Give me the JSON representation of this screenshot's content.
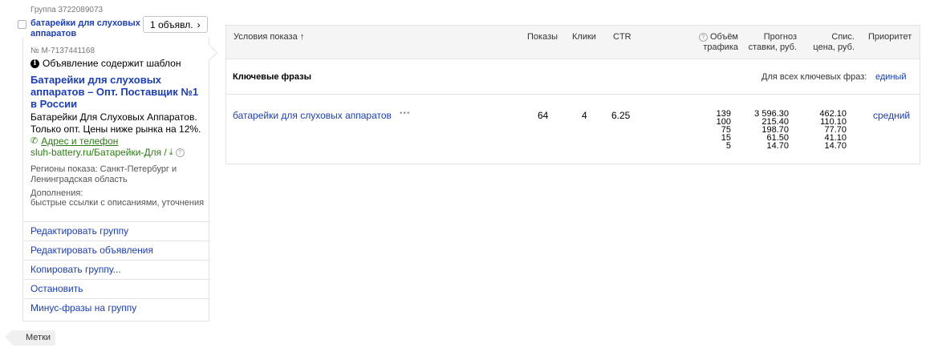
{
  "group": {
    "id_label": "Группа 3722089073",
    "name": "батарейки для слуховых аппаратов",
    "ads_count_label": "1 объявл."
  },
  "ad": {
    "number": "№ М-7137441168",
    "template_note": "Объявление содержит шаблон",
    "title": "Батарейки для слуховых аппаратов – Опт. Поставщик №1 в России",
    "text": "Батарейки Для Слуховых Аппаратов. Только опт. Цены ниже рынка на 12%.",
    "address_label": "Адрес и телефон",
    "display_url": "sluh-battery.ru/Батарейки-Для /",
    "regions": "Регионы показа: Санкт-Петербург и Ленинградская область",
    "additions_label": "Дополнения:",
    "additions_value": "быстрые ссылки с описаниями, уточнения"
  },
  "actions": [
    "Редактировать группу",
    "Редактировать объявления",
    "Копировать группу...",
    "Остановить",
    "Минус-фразы на группу"
  ],
  "tags_label": "Метки",
  "table": {
    "headers": {
      "conditions": "Условия показа ↑",
      "impressions": "Показы",
      "clicks": "Клики",
      "ctr": "CTR",
      "traffic_line1": "Объём",
      "traffic_line2": "трафика",
      "forecast_line1": "Прогноз",
      "forecast_line2": "ставки, руб.",
      "writeoff_line1": "Спис.",
      "writeoff_line2": "цена, руб.",
      "priority": "Приоритет"
    },
    "section_title": "Ключевые фразы",
    "all_phrases_label": "Для всех ключевых фраз:",
    "all_phrases_value": "единый",
    "row": {
      "phrase": "батарейки для слуховых аппаратов",
      "impressions": "64",
      "clicks": "4",
      "ctr": "6.25",
      "traffic": [
        "139",
        "100",
        "75",
        "15",
        "5"
      ],
      "forecast": [
        "3 596.30",
        "215.40",
        "198.70",
        "61.50",
        "14.70"
      ],
      "writeoff": [
        "462.10",
        "110.10",
        "77.70",
        "41.10",
        "14.70"
      ],
      "priority": "средний"
    }
  },
  "colors": {
    "link": "#1a3dc1",
    "url_green": "#2a7d12",
    "header_bg": "#f5f5f5",
    "border": "#e3e3e3"
  },
  "icons": [
    "info-icon",
    "phone-icon",
    "download-icon",
    "help-icon",
    "chevron-right-icon",
    "more-dots-icon",
    "tag-icon"
  ]
}
